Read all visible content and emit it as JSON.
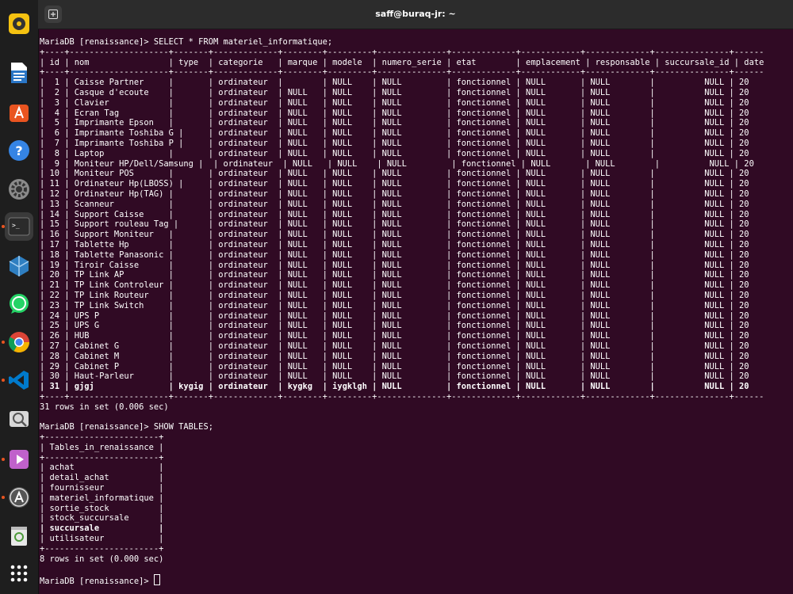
{
  "window": {
    "title": "saff@buraq-jr: ~"
  },
  "dock": {
    "items": [
      {
        "name": "rhythmbox",
        "color": "#f5c211"
      },
      {
        "name": "libreoffice-writer",
        "color": "#2a76c6"
      },
      {
        "name": "ubuntu-software",
        "color": "#e95420"
      },
      {
        "name": "help",
        "color": "#3584e4"
      },
      {
        "name": "settings",
        "color": "#9a9a9a"
      },
      {
        "name": "terminal",
        "color": "#2b2b2b"
      },
      {
        "name": "virtualbox",
        "color": "#2f7fc1"
      },
      {
        "name": "whatsapp",
        "color": "#25d366"
      },
      {
        "name": "chrome",
        "color": "#db4437"
      },
      {
        "name": "vscode",
        "color": "#007acc"
      },
      {
        "name": "screenshot",
        "color": "#c0c0c0"
      },
      {
        "name": "media-player",
        "color": "#c061cb"
      },
      {
        "name": "software-updater",
        "color": "#e95420"
      },
      {
        "name": "trash",
        "color": "#6a9a5a"
      },
      {
        "name": "show-apps",
        "color": "#ffffff"
      }
    ]
  },
  "terminal": {
    "lines": [
      "MariaDB [renaissance]> SELECT * FROM materiel_informatique;",
      "+----+--------------------+-------+-------------+--------+---------+--------------+-------------+------------+-------------+---------------+------",
      "| id | nom                | type  | categorie   | marque | modele  | numero_serie | etat        | emplacement | responsable | succursale_id | date",
      "+----+--------------------+-------+-------------+--------+---------+--------------+-------------+------------+-------------+---------------+------",
      "|  1 | Caisse Partner     |       | ordinateur  |        | NULL    | NULL         | fonctionnel | NULL       | NULL        |          NULL | 20",
      "|  2 | Casque d'ecoute    |       | ordinateur  | NULL   | NULL    | NULL         | fonctionnel | NULL       | NULL        |          NULL | 20",
      "|  3 | Clavier            |       | ordinateur  | NULL   | NULL    | NULL         | fonctionnel | NULL       | NULL        |          NULL | 20",
      "|  4 | Ecran Tag          |       | ordinateur  | NULL   | NULL    | NULL         | fonctionnel | NULL       | NULL        |          NULL | 20",
      "|  5 | Imprimante Epson   |       | ordinateur  | NULL   | NULL    | NULL         | fonctionnel | NULL       | NULL        |          NULL | 20",
      "|  6 | Imprimante Toshiba G |     | ordinateur  | NULL   | NULL    | NULL         | fonctionnel | NULL       | NULL        |          NULL | 20",
      "|  7 | Imprimante Toshiba P |     | ordinateur  | NULL   | NULL    | NULL         | fonctionnel | NULL       | NULL        |          NULL | 20",
      "|  8 | Laptop             |       | ordinateur  | NULL   | NULL    | NULL         | fonctionnel | NULL       | NULL        |          NULL | 20",
      "|  9 | Moniteur HP/Dell/Samsung |  | ordinateur  | NULL   | NULL    | NULL         | fonctionnel | NULL       | NULL        |          NULL | 20",
      "| 10 | Moniteur POS       |       | ordinateur  | NULL   | NULL    | NULL         | fonctionnel | NULL       | NULL        |          NULL | 20",
      "| 11 | Ordinateur Hp(LBOSS) |     | ordinateur  | NULL   | NULL    | NULL         | fonctionnel | NULL       | NULL        |          NULL | 20",
      "| 12 | Ordinateur Hp(TAG) |       | ordinateur  | NULL   | NULL    | NULL         | fonctionnel | NULL       | NULL        |          NULL | 20",
      "| 13 | Scanneur           |       | ordinateur  | NULL   | NULL    | NULL         | fonctionnel | NULL       | NULL        |          NULL | 20",
      "| 14 | Support Caisse     |       | ordinateur  | NULL   | NULL    | NULL         | fonctionnel | NULL       | NULL        |          NULL | 20",
      "| 15 | Support rouleau Tag |      | ordinateur  | NULL   | NULL    | NULL         | fonctionnel | NULL       | NULL        |          NULL | 20",
      "| 16 | Support Moniteur   |       | ordinateur  | NULL   | NULL    | NULL         | fonctionnel | NULL       | NULL        |          NULL | 20",
      "| 17 | Tablette Hp        |       | ordinateur  | NULL   | NULL    | NULL         | fonctionnel | NULL       | NULL        |          NULL | 20",
      "| 18 | Tablette Panasonic |       | ordinateur  | NULL   | NULL    | NULL         | fonctionnel | NULL       | NULL        |          NULL | 20",
      "| 19 | Tiroir Caisse      |       | ordinateur  | NULL   | NULL    | NULL         | fonctionnel | NULL       | NULL        |          NULL | 20",
      "| 20 | TP Link AP         |       | ordinateur  | NULL   | NULL    | NULL         | fonctionnel | NULL       | NULL        |          NULL | 20",
      "| 21 | TP Link Controleur |       | ordinateur  | NULL   | NULL    | NULL         | fonctionnel | NULL       | NULL        |          NULL | 20",
      "| 22 | TP Link Routeur    |       | ordinateur  | NULL   | NULL    | NULL         | fonctionnel | NULL       | NULL        |          NULL | 20",
      "| 23 | TP Link Switch     |       | ordinateur  | NULL   | NULL    | NULL         | fonctionnel | NULL       | NULL        |          NULL | 20",
      "| 24 | UPS P              |       | ordinateur  | NULL   | NULL    | NULL         | fonctionnel | NULL       | NULL        |          NULL | 20",
      "| 25 | UPS G              |       | ordinateur  | NULL   | NULL    | NULL         | fonctionnel | NULL       | NULL        |          NULL | 20",
      "| 26 | HUB                |       | ordinateur  | NULL   | NULL    | NULL         | fonctionnel | NULL       | NULL        |          NULL | 20",
      "| 27 | Cabinet G          |       | ordinateur  | NULL   | NULL    | NULL         | fonctionnel | NULL       | NULL        |          NULL | 20",
      "| 28 | Cabinet M          |       | ordinateur  | NULL   | NULL    | NULL         | fonctionnel | NULL       | NULL        |          NULL | 20",
      "| 29 | Cabinet P          |       | ordinateur  | NULL   | NULL    | NULL         | fonctionnel | NULL       | NULL        |          NULL | 20",
      "| 30 | Haut-Parleur       |       | ordinateur  | NULL   | NULL    | NULL         | fonctionnel | NULL       | NULL        |          NULL | 20",
      "| 31 | gjgj               | kygig | ordinateur  | kygkg  | iygklgh | NULL         | fonctionnel | NULL       | NULL        |          NULL | 20",
      "+----+--------------------+-------+-------------+--------+---------+--------------+-------------+------------+-------------+---------------+------",
      "31 rows in set (0.006 sec)",
      "",
      "MariaDB [renaissance]> SHOW TABLES;",
      "+-----------------------+",
      "| Tables_in_renaissance |",
      "+-----------------------+",
      "| achat                 |",
      "| detail_achat          |",
      "| fournisseur           |",
      "| materiel_informatique |",
      "| sortie_stock          |",
      "| stock_succursale      |",
      "| succursale            |",
      "| utilisateur           |",
      "+-----------------------+",
      "8 rows in set (0.000 sec)",
      "",
      "MariaDB [renaissance]> "
    ],
    "bold_lines": [
      34,
      48
    ]
  }
}
